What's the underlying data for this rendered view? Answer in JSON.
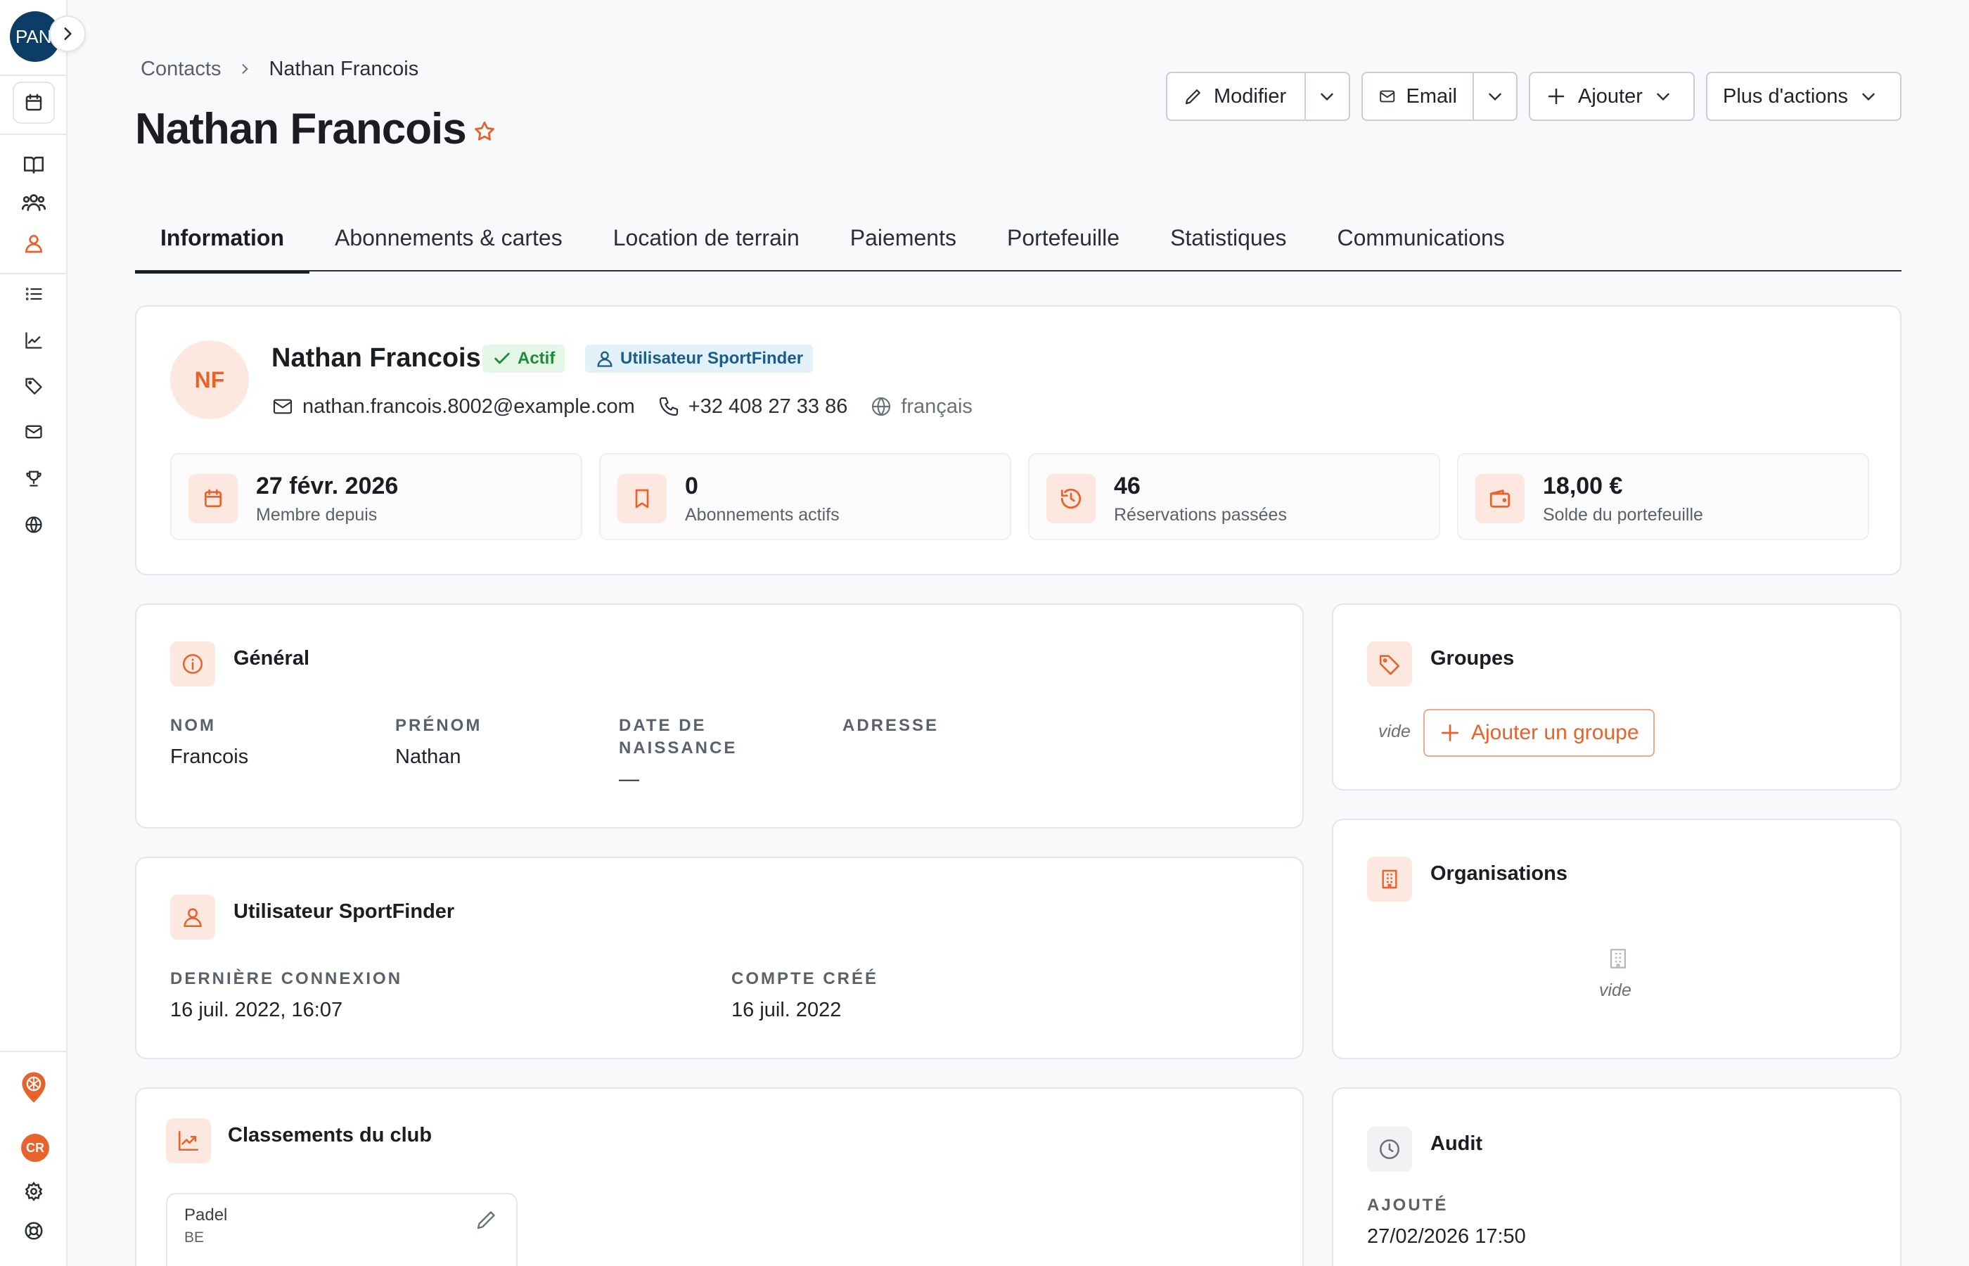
{
  "sidebar": {
    "avatar_text": "PAN",
    "items": [
      {
        "name": "calendar-icon"
      },
      {
        "name": "book-icon"
      },
      {
        "name": "users-icon"
      },
      {
        "name": "contact-icon"
      },
      {
        "name": "list-icon"
      },
      {
        "name": "chart-icon"
      },
      {
        "name": "tag-icon"
      },
      {
        "name": "mail-icon"
      },
      {
        "name": "trophy-icon"
      },
      {
        "name": "globe-icon"
      }
    ],
    "bottom": {
      "club_badge": "CR"
    }
  },
  "breadcrumb": {
    "parent": "Contacts",
    "current": "Nathan Francois"
  },
  "page_title": "Nathan Francois",
  "actions": {
    "modifier": "Modifier",
    "email": "Email",
    "ajouter": "Ajouter",
    "plus": "Plus d'actions"
  },
  "tabs": [
    {
      "label": "Information",
      "active": true
    },
    {
      "label": "Abonnements & cartes"
    },
    {
      "label": "Location de terrain"
    },
    {
      "label": "Paiements"
    },
    {
      "label": "Portefeuille"
    },
    {
      "label": "Statistiques"
    },
    {
      "label": "Communications"
    }
  ],
  "profile": {
    "initials": "NF",
    "name": "Nathan Francois",
    "status_badge": "Actif",
    "user_badge": "Utilisateur SportFinder",
    "email": "nathan.francois.8002@example.com",
    "phone": "+32 408 27 33 86",
    "language": "français",
    "stats": [
      {
        "value": "27 févr. 2026",
        "label": "Membre depuis"
      },
      {
        "value": "0",
        "label": "Abonnements actifs"
      },
      {
        "value": "46",
        "label": "Réservations passées"
      },
      {
        "value": "18,00 €",
        "label": "Solde du portefeuille"
      }
    ]
  },
  "general": {
    "title": "Général",
    "fields": [
      {
        "label": "NOM",
        "value": "Francois"
      },
      {
        "label": "PRÉNOM",
        "value": "Nathan"
      },
      {
        "label": "DATE DE NAISSANCE",
        "value": "—"
      },
      {
        "label": "ADRESSE",
        "value": ""
      }
    ]
  },
  "sportfinder": {
    "title": "Utilisateur SportFinder",
    "last_login_label": "DERNIÈRE CONNEXION",
    "last_login_value": "16 juil. 2022, 16:07",
    "created_label": "COMPTE CRÉÉ",
    "created_value": "16 juil. 2022"
  },
  "rankings": {
    "title": "Classements du club",
    "sport": "Padel",
    "country": "BE"
  },
  "groups": {
    "title": "Groupes",
    "empty": "vide",
    "add_button": "Ajouter un groupe"
  },
  "organisations": {
    "title": "Organisations",
    "empty": "vide"
  },
  "audit": {
    "title": "Audit",
    "added_label": "AJOUTÉ",
    "added_value": "27/02/2026 17:50"
  },
  "colors": {
    "accent": "#e8622c",
    "accent_soft": "#fde8e0",
    "navy": "#0b3d66",
    "success": "#1f8a3a"
  }
}
